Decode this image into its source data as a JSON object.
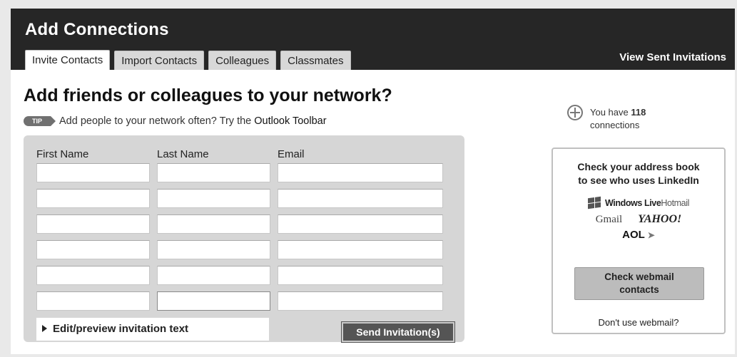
{
  "header": {
    "title": "Add Connections",
    "view_sent": "View Sent Invitations",
    "tabs": [
      {
        "label": "Invite Contacts",
        "active": true
      },
      {
        "label": "Import Contacts",
        "active": false
      },
      {
        "label": "Colleagues",
        "active": false
      },
      {
        "label": "Classmates",
        "active": false
      }
    ]
  },
  "main": {
    "title": "Add friends or colleagues to your network?",
    "tip_badge": "TIP",
    "tip_text": "Add people to your network often? Try the",
    "tip_link": "Outlook Toolbar"
  },
  "form": {
    "columns": {
      "first_name": "First Name",
      "last_name": "Last Name",
      "email": "Email"
    },
    "rows": 6,
    "edit_preview": "Edit/preview invitation text",
    "send_button": "Send Invitation(s)"
  },
  "sidebar": {
    "connections_prefix": "You have",
    "connections_count": "118",
    "connections_suffix": "connections",
    "box_title_line1": "Check your address book",
    "box_title_line2": "to see who uses LinkedIn",
    "providers": {
      "hotmail_bold": "Windows Live",
      "hotmail_light": "Hotmail",
      "gmail": "Gmail",
      "yahoo": "YAHOO!",
      "aol": "AOL"
    },
    "webmail_button_line1": "Check webmail",
    "webmail_button_line2": "contacts",
    "no_webmail": "Don't use webmail?"
  }
}
